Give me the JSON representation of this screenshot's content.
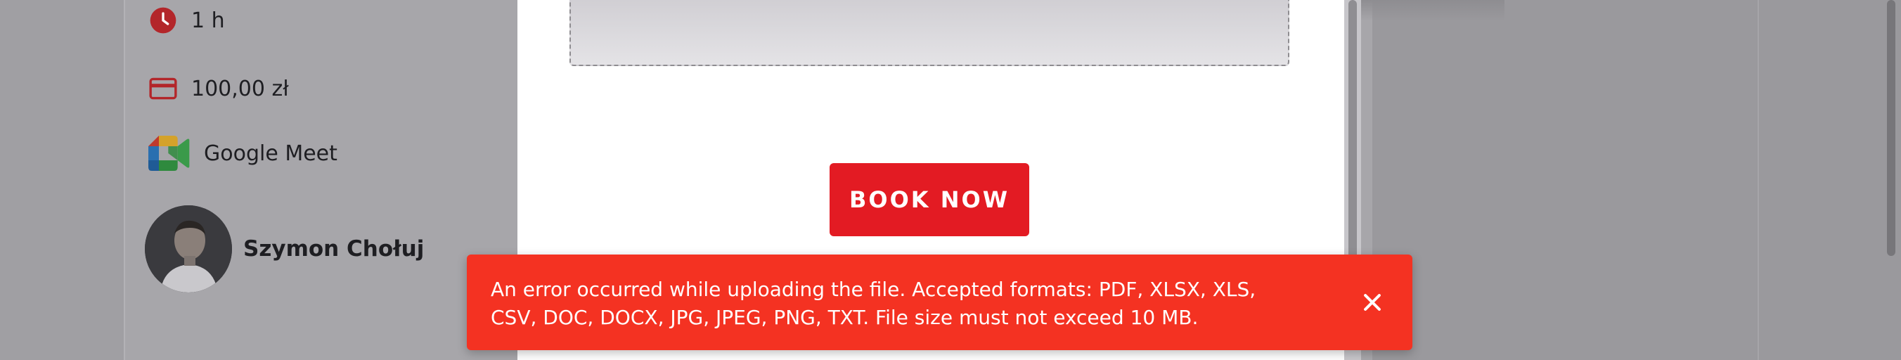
{
  "event_details": {
    "duration": "1 h",
    "price": "100,00 zł",
    "location": "Google Meet",
    "host_name": "Szymon Chołuj"
  },
  "booking_form": {
    "book_button_label": "BOOK NOW"
  },
  "error_toast": {
    "message": "An error occurred while uploading the file. Accepted formats: PDF, XLSX, XLS, CSV, DOC, DOCX, JPG, JPEG, PNG, TXT. File size must not exceed 10 MB."
  },
  "colors": {
    "accent": "#e31b23",
    "error": "#f43222",
    "icon": "#c62828"
  },
  "icons": [
    "clock-icon",
    "credit-card-icon",
    "google-meet-icon",
    "close-icon"
  ]
}
